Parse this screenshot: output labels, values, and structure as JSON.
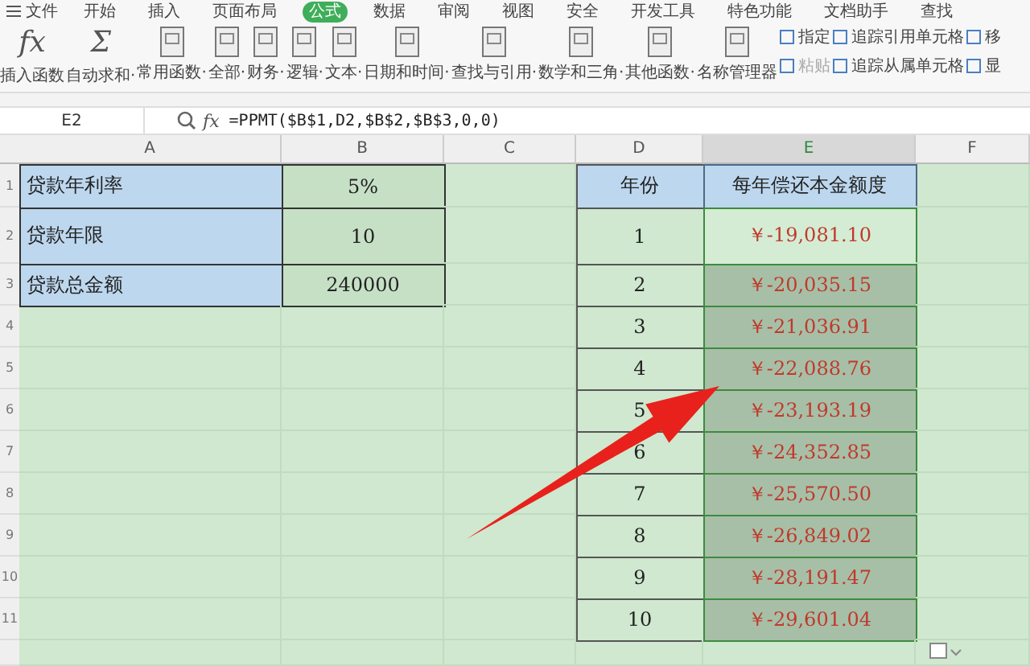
{
  "menu_bar": {
    "file_menu": "文件",
    "tabs": [
      {
        "label": "开始",
        "selected": false
      },
      {
        "label": "插入",
        "selected": false
      },
      {
        "label": "页面布局",
        "selected": false
      },
      {
        "label": "公式",
        "selected": true
      },
      {
        "label": "数据",
        "selected": false
      },
      {
        "label": "审阅",
        "selected": false
      },
      {
        "label": "视图",
        "selected": false
      },
      {
        "label": "安全",
        "selected": false
      },
      {
        "label": "开发工具",
        "selected": false
      },
      {
        "label": "特色功能",
        "selected": false
      },
      {
        "label": "文档助手",
        "selected": false
      }
    ],
    "search": "查找"
  },
  "ribbon": {
    "buttons": [
      {
        "kind": "glyph",
        "glyph": "fx",
        "label": "插入函数"
      },
      {
        "kind": "glyph",
        "glyph": "Σ",
        "label": "自动求和·"
      },
      {
        "kind": "box",
        "label": "常用函数·"
      },
      {
        "kind": "box",
        "label": "全部·"
      },
      {
        "kind": "box",
        "label": "财务·"
      },
      {
        "kind": "box",
        "label": "逻辑·"
      },
      {
        "kind": "box",
        "label": "文本·"
      },
      {
        "kind": "box",
        "label": "日期和时间·"
      },
      {
        "kind": "box",
        "label": "查找与引用·"
      },
      {
        "kind": "box",
        "label": "数学和三角·"
      },
      {
        "kind": "box",
        "label": "其他函数·"
      },
      {
        "kind": "box",
        "label": "名称管理器"
      }
    ],
    "small_buttons": [
      {
        "label": "指定",
        "disabled": false
      },
      {
        "label": "粘贴",
        "disabled": true
      },
      {
        "label": "追踪引用单元格",
        "disabled": false
      },
      {
        "label": "追踪从属单元格",
        "disabled": false
      },
      {
        "label": "移",
        "disabled": false
      },
      {
        "label": "显",
        "disabled": false
      }
    ]
  },
  "formula_bar": {
    "name_box": "E2",
    "fx": "fx",
    "formula": "=PPMT($B$1,D2,$B$2,$B$3,0,0)"
  },
  "sheet": {
    "columns": [
      {
        "label": "A",
        "selected": false
      },
      {
        "label": "B",
        "selected": false
      },
      {
        "label": "C",
        "selected": false
      },
      {
        "label": "D",
        "selected": false
      },
      {
        "label": "E",
        "selected": true
      },
      {
        "label": "F",
        "selected": false
      }
    ],
    "rows": [
      {
        "number": "1",
        "a": "贷款年利率",
        "b": "5%",
        "d": "年份",
        "e": "每年偿还本金额度",
        "e_selected": false,
        "e_active": false
      },
      {
        "number": "2",
        "a": "贷款年限",
        "b": "10",
        "d": "1",
        "e": "￥-19,081.10",
        "e_selected": true,
        "e_active": true
      },
      {
        "number": "3",
        "a": "贷款总金额",
        "b": "240000",
        "d": "2",
        "e": "￥-20,035.15",
        "e_selected": true,
        "e_active": false
      },
      {
        "number": "4",
        "d": "3",
        "e": "￥-21,036.91",
        "e_selected": true,
        "e_active": false
      },
      {
        "number": "5",
        "d": "4",
        "e": "￥-22,088.76",
        "e_selected": true,
        "e_active": false
      },
      {
        "number": "6",
        "d": "5",
        "e": "￥-23,193.19",
        "e_selected": true,
        "e_active": false
      },
      {
        "number": "7",
        "d": "6",
        "e": "￥-24,352.85",
        "e_selected": true,
        "e_active": false
      },
      {
        "number": "8",
        "d": "7",
        "e": "￥-25,570.50",
        "e_selected": true,
        "e_active": false
      },
      {
        "number": "9",
        "d": "8",
        "e": "￥-26,849.02",
        "e_selected": true,
        "e_active": false
      },
      {
        "number": "10",
        "d": "9",
        "e": "￥-28,191.47",
        "e_selected": true,
        "e_active": false
      },
      {
        "number": "11",
        "d": "10",
        "e": "￥-29,601.04",
        "e_selected": true,
        "e_active": false
      }
    ]
  }
}
